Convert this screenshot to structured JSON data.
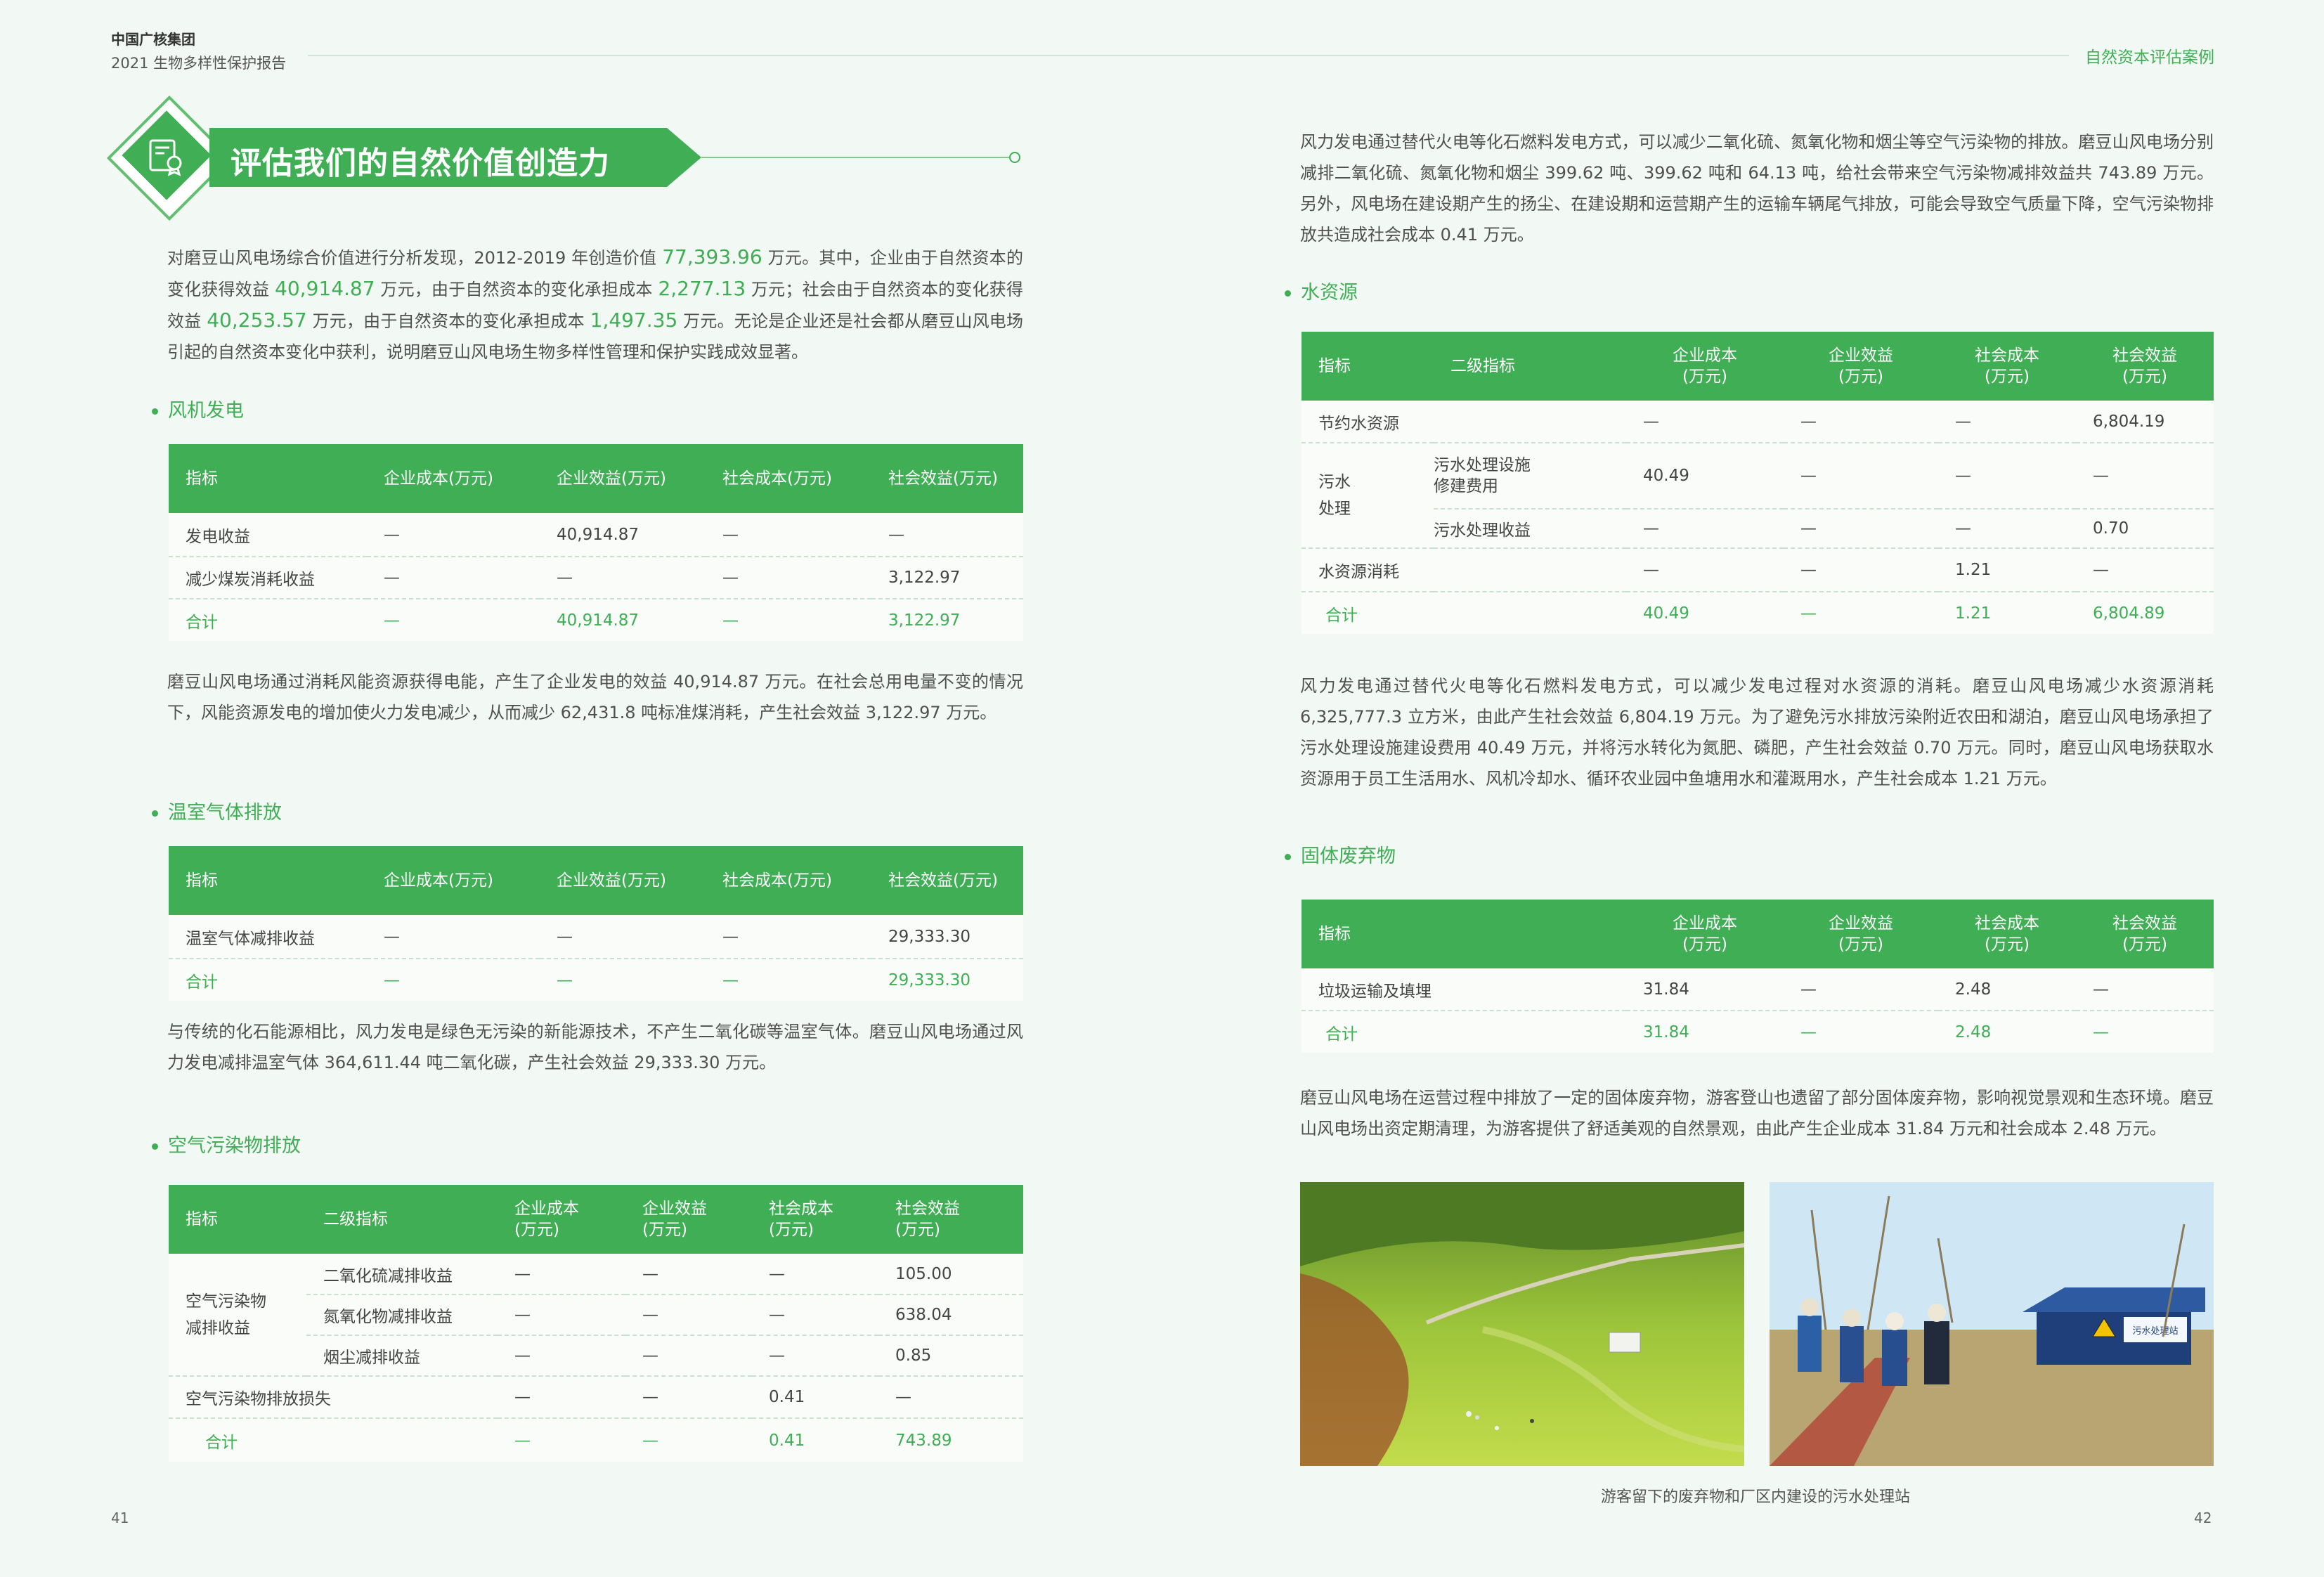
{
  "header": {
    "org": "中国广核集团",
    "report": "2021 生物多样性保护报告",
    "section_tag": "自然资本评估案例"
  },
  "pages": {
    "left": "41",
    "right": "42"
  },
  "title": "评估我们的自然价值创造力",
  "intro": {
    "s1": "对磨豆山风电场综合价值进行分析发现，2012-2019 年创造价值 ",
    "v1": "77,393.96",
    "s2": " 万元。其中，企业由于自然资本的变化获得效益 ",
    "v2": "40,914.87",
    "s3": " 万元，由于自然资本的变化承担成本 ",
    "v3": "2,277.13",
    "s4": " 万元；社会由于自然资本的变化获得效益 ",
    "v4": "40,253.57",
    "s5": " 万元，由于自然资本的变化承担成本 ",
    "v5": "1,497.35",
    "s6": " 万元。无论是企业还是社会都从磨豆山风电场引起的自然资本变化中获利，说明磨豆山风电场生物多样性管理和保护实践成效显著。"
  },
  "sections": {
    "wind": "风机发电",
    "ghg": "温室气体排放",
    "air": "空气污染物排放",
    "water": "水资源",
    "waste": "固体废弃物"
  },
  "wind_table": {
    "headers": [
      "指标",
      "企业成本(万元)",
      "企业效益(万元)",
      "社会成本(万元)",
      "社会效益(万元)"
    ],
    "rows": [
      [
        "发电收益",
        "—",
        "40,914.87",
        "—",
        "—"
      ],
      [
        "减少煤炭消耗收益",
        "—",
        "—",
        "—",
        "3,122.97"
      ]
    ],
    "total": [
      "合计",
      "—",
      "40,914.87",
      "—",
      "3,122.97"
    ]
  },
  "wind_text": "磨豆山风电场通过消耗风能资源获得电能，产生了企业发电的效益 40,914.87 万元。在社会总用电量不变的情况下，风能资源发电的增加使火力发电减少，从而减少 62,431.8 吨标准煤消耗，产生社会效益 3,122.97 万元。",
  "ghg_table": {
    "headers": [
      "指标",
      "企业成本(万元)",
      "企业效益(万元)",
      "社会成本(万元)",
      "社会效益(万元)"
    ],
    "rows": [
      [
        "温室气体减排收益",
        "—",
        "—",
        "—",
        "29,333.30"
      ]
    ],
    "total": [
      "合计",
      "—",
      "—",
      "—",
      "29,333.30"
    ]
  },
  "ghg_text": "与传统的化石能源相比，风力发电是绿色无污染的新能源技术，不产生二氧化碳等温室气体。磨豆山风电场通过风力发电减排温室气体 364,611.44 吨二氧化碳，产生社会效益 29,333.30 万元。",
  "air_table": {
    "headers": [
      "指标",
      "二级指标",
      "企业成本\n(万元)",
      "企业效益\n(万元)",
      "社会成本\n(万元)",
      "社会效益\n(万元)"
    ],
    "group": "空气污染物\n减排收益",
    "group_rows": [
      [
        "二氧化硫减排收益",
        "—",
        "—",
        "—",
        "105.00"
      ],
      [
        "氮氧化物减排收益",
        "—",
        "—",
        "—",
        "638.04"
      ],
      [
        "烟尘减排收益",
        "—",
        "—",
        "—",
        "0.85"
      ]
    ],
    "loss_row": [
      "空气污染物排放损失",
      "—",
      "—",
      "0.41",
      "—"
    ],
    "total": [
      "合计",
      "—",
      "—",
      "0.41",
      "743.89"
    ]
  },
  "air_text": "风力发电通过替代火电等化石燃料发电方式，可以减少二氧化硫、氮氧化物和烟尘等空气污染物的排放。磨豆山风电场分别减排二氧化硫、氮氧化物和烟尘 399.62 吨、399.62 吨和 64.13 吨，给社会带来空气污染物减排效益共 743.89 万元。另外，风电场在建设期产生的扬尘、在建设期和运营期产生的运输车辆尾气排放，可能会导致空气质量下降，空气污染物排放共造成社会成本 0.41 万元。",
  "water_table": {
    "headers": [
      "指标",
      "二级指标",
      "企业成本\n(万元)",
      "企业效益\n(万元)",
      "社会成本\n(万元)",
      "社会效益\n(万元)"
    ],
    "row1": [
      "节约水资源",
      "—",
      "—",
      "—",
      "6,804.19"
    ],
    "group": "污水\n处理",
    "group_rows": [
      [
        "污水处理设施\n修建费用",
        "40.49",
        "—",
        "—",
        "—"
      ],
      [
        "污水处理收益",
        "—",
        "—",
        "—",
        "0.70"
      ]
    ],
    "row_last": [
      "水资源消耗",
      "—",
      "—",
      "1.21",
      "—"
    ],
    "total": [
      "合计",
      "40.49",
      "—",
      "1.21",
      "6,804.89"
    ]
  },
  "water_text": "风力发电通过替代火电等化石燃料发电方式，可以减少发电过程对水资源的消耗。磨豆山风电场减少水资源消耗 6,325,777.3 立方米，由此产生社会效益 6,804.19 万元。为了避免污水排放污染附近农田和湖泊，磨豆山风电场承担了污水处理设施建设费用 40.49 万元，并将污水转化为氮肥、磷肥，产生社会效益 0.70 万元。同时，磨豆山风电场获取水资源用于员工生活用水、风机冷却水、循环农业园中鱼塘用水和灌溉用水，产生社会成本 1.21 万元。",
  "waste_table": {
    "headers": [
      "指标",
      "企业成本\n(万元)",
      "企业效益\n(万元)",
      "社会成本\n(万元)",
      "社会效益\n(万元)"
    ],
    "rows": [
      [
        "垃圾运输及填埋",
        "31.84",
        "—",
        "2.48",
        "—"
      ]
    ],
    "total": [
      "合计",
      "31.84",
      "—",
      "2.48",
      "—"
    ]
  },
  "waste_text": "磨豆山风电场在运营过程中排放了一定的固体废弃物，游客登山也遗留了部分固体废弃物，影响视觉景观和生态环境。磨豆山风电场出资定期清理，为游客提供了舒适美观的自然景观，由此产生企业成本 31.84 万元和社会成本 2.48 万元。",
  "photos": {
    "sign_text": "污水处理站",
    "caption": "游客留下的废弃物和厂区内建设的污水处理站"
  },
  "colors": {
    "accent": "#3fae55",
    "background": "#f2f8f3"
  }
}
